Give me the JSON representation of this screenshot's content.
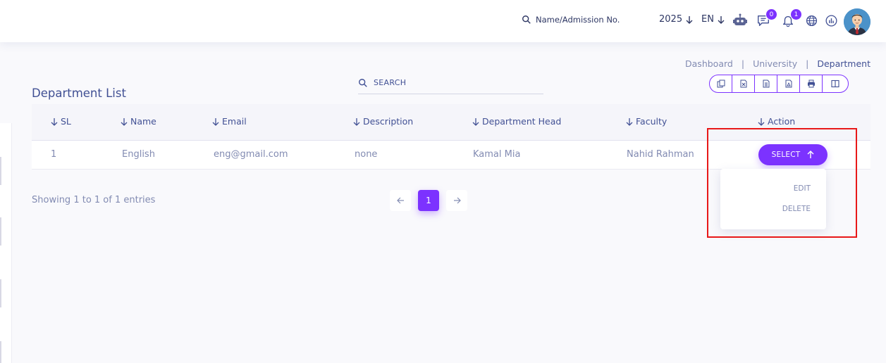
{
  "topbar": {
    "search_placeholder": "Name/Admission No.",
    "year": "2025",
    "language": "EN",
    "chat_count": "0",
    "notification_count": "1"
  },
  "breadcrumb": {
    "items": [
      "Dashboard",
      "University",
      "Department"
    ],
    "separator": "|"
  },
  "page": {
    "title": "Department List"
  },
  "table_search": {
    "placeholder": "SEARCH"
  },
  "table": {
    "headers": [
      "SL",
      "Name",
      "Email",
      "Description",
      "Department Head",
      "Faculty",
      "Action"
    ],
    "rows": [
      {
        "sl": "1",
        "name": "English",
        "email": "eng@gmail.com",
        "description": "none",
        "head": "Kamal Mia",
        "faculty": "Nahid Rahman"
      }
    ]
  },
  "action": {
    "select_label": "SELECT",
    "menu": [
      "EDIT",
      "DELETE"
    ]
  },
  "footer": {
    "showing": "Showing 1 to 1 of 1 entries",
    "current_page": "1"
  },
  "colors": {
    "accent": "#7c32ff",
    "text": "#415094",
    "muted": "#828bb2",
    "highlight": "#e81818"
  },
  "icons": [
    "search-icon",
    "arrow-down-icon",
    "robot-icon",
    "chat-icon",
    "bell-icon",
    "globe-icon",
    "chart-icon",
    "copy-icon",
    "excel-icon",
    "csv-icon",
    "pdf-icon",
    "print-icon",
    "columns-icon",
    "arrow-up-icon",
    "chevron-left-icon",
    "chevron-right-icon"
  ]
}
